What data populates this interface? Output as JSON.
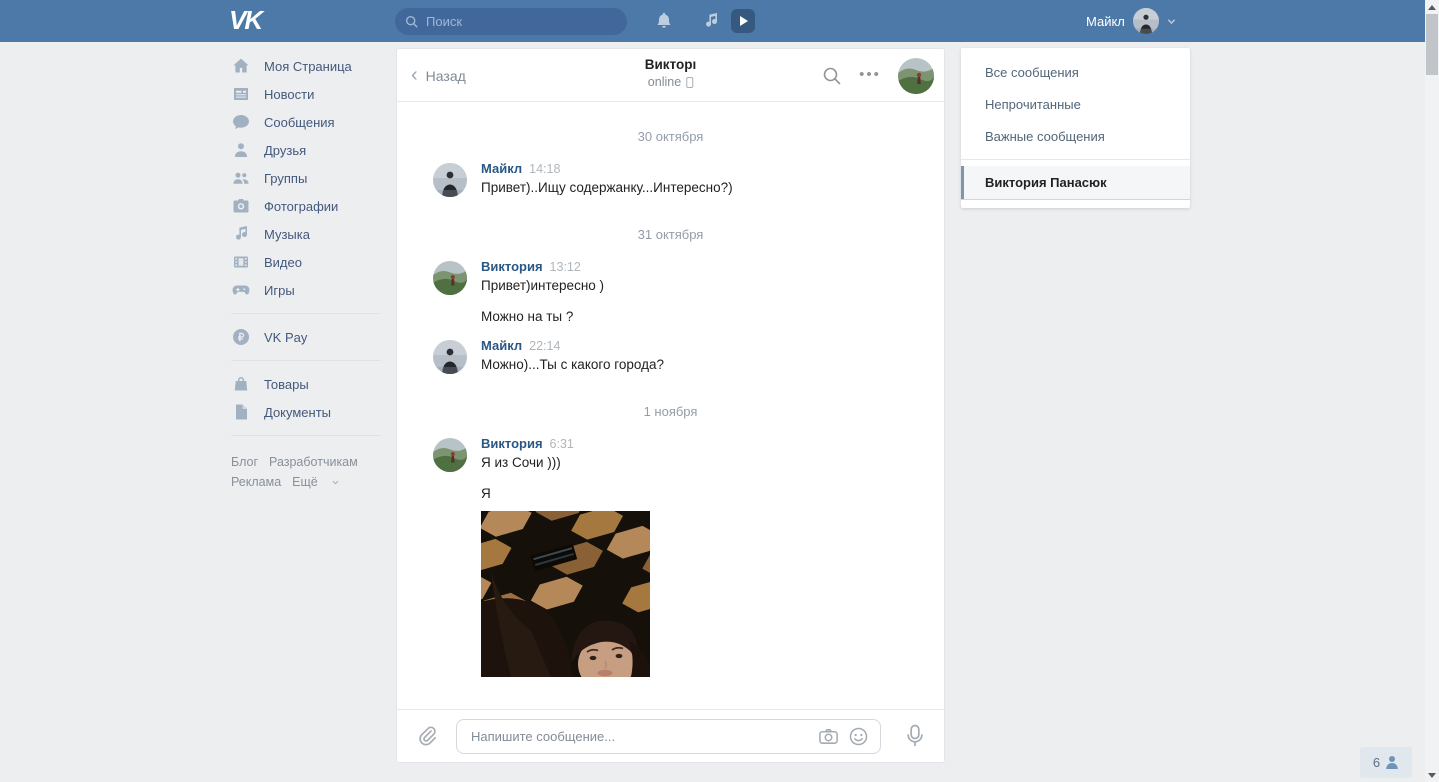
{
  "topbar": {
    "logo": "VK",
    "search_placeholder": "Поиск",
    "user_name": "Майкл",
    "icons": [
      "search-icon",
      "bell-icon",
      "music-icon",
      "video-play-icon",
      "chevron-down-icon"
    ]
  },
  "sidebar": {
    "items": [
      {
        "label": "Моя Страница",
        "icon": "home-icon"
      },
      {
        "label": "Новости",
        "icon": "news-icon"
      },
      {
        "label": "Сообщения",
        "icon": "messages-icon"
      },
      {
        "label": "Друзья",
        "icon": "friends-icon"
      },
      {
        "label": "Группы",
        "icon": "groups-icon"
      },
      {
        "label": "Фотографии",
        "icon": "camera-icon"
      },
      {
        "label": "Музыка",
        "icon": "music-note-icon"
      },
      {
        "label": "Видео",
        "icon": "video-icon"
      },
      {
        "label": "Игры",
        "icon": "gamepad-icon"
      }
    ],
    "extra_items": [
      {
        "label": "VK Pay",
        "icon": "vkpay-ruble-icon"
      },
      {
        "label": "Товары",
        "icon": "market-bag-icon"
      },
      {
        "label": "Документы",
        "icon": "document-icon"
      }
    ],
    "footer_links": [
      "Блог",
      "Разработчикам",
      "Реклама",
      "Ещё"
    ]
  },
  "chat": {
    "back_label": "Назад",
    "title": "Викторı",
    "status": "online",
    "composer_placeholder": "Напишите сообщение...",
    "messages": [
      {
        "type": "date",
        "text": "30 октября"
      },
      {
        "type": "message",
        "author": "Майкл",
        "time": "14:18",
        "text": "Привет)..Ищу содержанку...Интересно?)"
      },
      {
        "type": "date",
        "text": "31 октября"
      },
      {
        "type": "message",
        "author": "Виктория",
        "time": "13:12",
        "text": "Привет)интересно )"
      },
      {
        "type": "followup",
        "text": "Можно на ты ?"
      },
      {
        "type": "message",
        "author": "Майкл",
        "time": "22:14",
        "text": "Можно)...Ты с какого города?"
      },
      {
        "type": "date",
        "text": "1 ноября"
      },
      {
        "type": "message",
        "author": "Виктория",
        "time": "6:31",
        "text": "Я из Сочи )))"
      },
      {
        "type": "followup",
        "text": "Я"
      },
      {
        "type": "photo",
        "description": "photo-attachment"
      }
    ]
  },
  "messages_menu": {
    "items": [
      "Все сообщения",
      "Непрочитанные",
      "Важные сообщения"
    ],
    "selected_conversation": "Виктория Панасюк"
  },
  "online_counter": {
    "count": "6",
    "icon": "person-icon"
  },
  "colors": {
    "topbar_bg": "#4d79a8",
    "page_bg": "#edeef0",
    "link_blue": "#2a5885",
    "card_bg": "#ffffff",
    "divider": "#e7e8ec",
    "muted_gray": "#828c99",
    "selected_accent": "#7e96ad"
  }
}
